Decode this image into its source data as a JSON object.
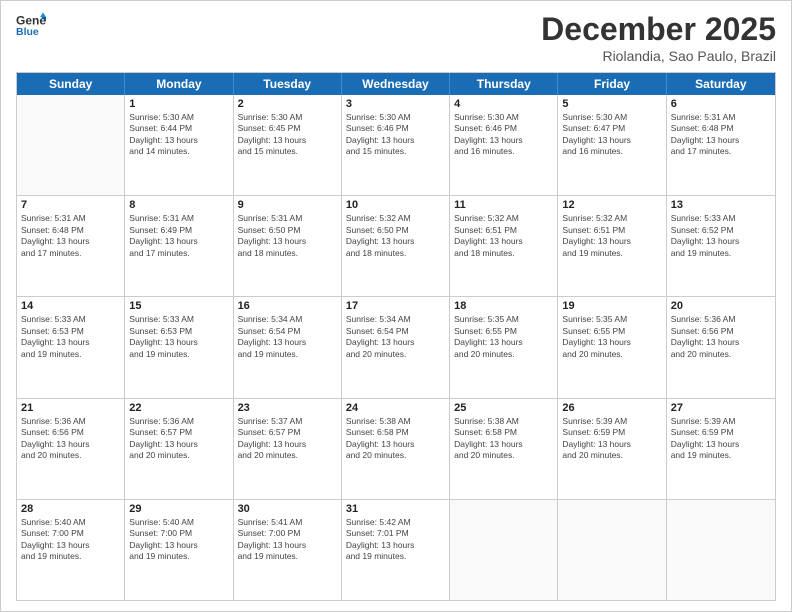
{
  "header": {
    "logo_line1": "General",
    "logo_line2": "Blue",
    "month": "December 2025",
    "location": "Riolandia, Sao Paulo, Brazil"
  },
  "weekdays": [
    "Sunday",
    "Monday",
    "Tuesday",
    "Wednesday",
    "Thursday",
    "Friday",
    "Saturday"
  ],
  "weeks": [
    [
      {
        "day": "",
        "info": ""
      },
      {
        "day": "1",
        "info": "Sunrise: 5:30 AM\nSunset: 6:44 PM\nDaylight: 13 hours\nand 14 minutes."
      },
      {
        "day": "2",
        "info": "Sunrise: 5:30 AM\nSunset: 6:45 PM\nDaylight: 13 hours\nand 15 minutes."
      },
      {
        "day": "3",
        "info": "Sunrise: 5:30 AM\nSunset: 6:46 PM\nDaylight: 13 hours\nand 15 minutes."
      },
      {
        "day": "4",
        "info": "Sunrise: 5:30 AM\nSunset: 6:46 PM\nDaylight: 13 hours\nand 16 minutes."
      },
      {
        "day": "5",
        "info": "Sunrise: 5:30 AM\nSunset: 6:47 PM\nDaylight: 13 hours\nand 16 minutes."
      },
      {
        "day": "6",
        "info": "Sunrise: 5:31 AM\nSunset: 6:48 PM\nDaylight: 13 hours\nand 17 minutes."
      }
    ],
    [
      {
        "day": "7",
        "info": "Sunrise: 5:31 AM\nSunset: 6:48 PM\nDaylight: 13 hours\nand 17 minutes."
      },
      {
        "day": "8",
        "info": "Sunrise: 5:31 AM\nSunset: 6:49 PM\nDaylight: 13 hours\nand 17 minutes."
      },
      {
        "day": "9",
        "info": "Sunrise: 5:31 AM\nSunset: 6:50 PM\nDaylight: 13 hours\nand 18 minutes."
      },
      {
        "day": "10",
        "info": "Sunrise: 5:32 AM\nSunset: 6:50 PM\nDaylight: 13 hours\nand 18 minutes."
      },
      {
        "day": "11",
        "info": "Sunrise: 5:32 AM\nSunset: 6:51 PM\nDaylight: 13 hours\nand 18 minutes."
      },
      {
        "day": "12",
        "info": "Sunrise: 5:32 AM\nSunset: 6:51 PM\nDaylight: 13 hours\nand 19 minutes."
      },
      {
        "day": "13",
        "info": "Sunrise: 5:33 AM\nSunset: 6:52 PM\nDaylight: 13 hours\nand 19 minutes."
      }
    ],
    [
      {
        "day": "14",
        "info": "Sunrise: 5:33 AM\nSunset: 6:53 PM\nDaylight: 13 hours\nand 19 minutes."
      },
      {
        "day": "15",
        "info": "Sunrise: 5:33 AM\nSunset: 6:53 PM\nDaylight: 13 hours\nand 19 minutes."
      },
      {
        "day": "16",
        "info": "Sunrise: 5:34 AM\nSunset: 6:54 PM\nDaylight: 13 hours\nand 19 minutes."
      },
      {
        "day": "17",
        "info": "Sunrise: 5:34 AM\nSunset: 6:54 PM\nDaylight: 13 hours\nand 20 minutes."
      },
      {
        "day": "18",
        "info": "Sunrise: 5:35 AM\nSunset: 6:55 PM\nDaylight: 13 hours\nand 20 minutes."
      },
      {
        "day": "19",
        "info": "Sunrise: 5:35 AM\nSunset: 6:55 PM\nDaylight: 13 hours\nand 20 minutes."
      },
      {
        "day": "20",
        "info": "Sunrise: 5:36 AM\nSunset: 6:56 PM\nDaylight: 13 hours\nand 20 minutes."
      }
    ],
    [
      {
        "day": "21",
        "info": "Sunrise: 5:36 AM\nSunset: 6:56 PM\nDaylight: 13 hours\nand 20 minutes."
      },
      {
        "day": "22",
        "info": "Sunrise: 5:36 AM\nSunset: 6:57 PM\nDaylight: 13 hours\nand 20 minutes."
      },
      {
        "day": "23",
        "info": "Sunrise: 5:37 AM\nSunset: 6:57 PM\nDaylight: 13 hours\nand 20 minutes."
      },
      {
        "day": "24",
        "info": "Sunrise: 5:38 AM\nSunset: 6:58 PM\nDaylight: 13 hours\nand 20 minutes."
      },
      {
        "day": "25",
        "info": "Sunrise: 5:38 AM\nSunset: 6:58 PM\nDaylight: 13 hours\nand 20 minutes."
      },
      {
        "day": "26",
        "info": "Sunrise: 5:39 AM\nSunset: 6:59 PM\nDaylight: 13 hours\nand 20 minutes."
      },
      {
        "day": "27",
        "info": "Sunrise: 5:39 AM\nSunset: 6:59 PM\nDaylight: 13 hours\nand 19 minutes."
      }
    ],
    [
      {
        "day": "28",
        "info": "Sunrise: 5:40 AM\nSunset: 7:00 PM\nDaylight: 13 hours\nand 19 minutes."
      },
      {
        "day": "29",
        "info": "Sunrise: 5:40 AM\nSunset: 7:00 PM\nDaylight: 13 hours\nand 19 minutes."
      },
      {
        "day": "30",
        "info": "Sunrise: 5:41 AM\nSunset: 7:00 PM\nDaylight: 13 hours\nand 19 minutes."
      },
      {
        "day": "31",
        "info": "Sunrise: 5:42 AM\nSunset: 7:01 PM\nDaylight: 13 hours\nand 19 minutes."
      },
      {
        "day": "",
        "info": ""
      },
      {
        "day": "",
        "info": ""
      },
      {
        "day": "",
        "info": ""
      }
    ]
  ]
}
